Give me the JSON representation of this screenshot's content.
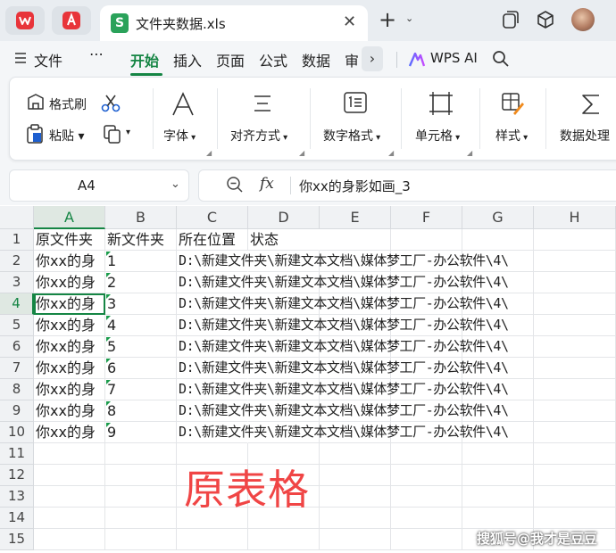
{
  "titlebar": {
    "doc_tab_title": "文件夹数据.xls",
    "doc_tab_icon_letter": "S",
    "close_glyph": "✕",
    "new_tab_glyph": "+",
    "tab_menu_glyph": "⌄"
  },
  "menubar": {
    "file_label": "文件",
    "more_label": "⋯",
    "tabs": [
      {
        "label": "开始",
        "active": true
      },
      {
        "label": "插入",
        "active": false
      },
      {
        "label": "页面",
        "active": false
      },
      {
        "label": "公式",
        "active": false
      },
      {
        "label": "数据",
        "active": false
      },
      {
        "label": "审",
        "active": false
      }
    ],
    "scroll_glyph": "›",
    "wps_ai_label": "WPS AI"
  },
  "ribbon": {
    "format_painter_label": "格式刷",
    "paste_label": "粘贴",
    "font_label": "字体",
    "align_label": "对齐方式",
    "number_format_label": "数字格式",
    "cell_label": "单元格",
    "style_label": "样式",
    "data_process_label": "数据处理"
  },
  "formula_bar": {
    "cell_ref": "A4",
    "fx_label": "fx",
    "formula_value": "你xx的身影如画_3"
  },
  "grid": {
    "selected_cell": "A4",
    "columns": [
      "A",
      "B",
      "C",
      "D",
      "E",
      "F",
      "G",
      "H"
    ],
    "rows": [
      "1",
      "2",
      "3",
      "4",
      "5",
      "6",
      "7",
      "8",
      "9",
      "10",
      "11",
      "12",
      "13",
      "14",
      "15"
    ],
    "header_row": {
      "a": "原文件夹",
      "b": "新文件夹",
      "c": "所在位置",
      "d": "状态"
    },
    "data_rows": [
      {
        "a": "你xx的身",
        "b": "1",
        "c": "D:\\新建文件夹\\新建文本文档\\媒体梦工厂-办公软件\\4\\"
      },
      {
        "a": "你xx的身",
        "b": "2",
        "c": "D:\\新建文件夹\\新建文本文档\\媒体梦工厂-办公软件\\4\\"
      },
      {
        "a": "你xx的身",
        "b": "3",
        "c": "D:\\新建文件夹\\新建文本文档\\媒体梦工厂-办公软件\\4\\"
      },
      {
        "a": "你xx的身",
        "b": "4",
        "c": "D:\\新建文件夹\\新建文本文档\\媒体梦工厂-办公软件\\4\\"
      },
      {
        "a": "你xx的身",
        "b": "5",
        "c": "D:\\新建文件夹\\新建文本文档\\媒体梦工厂-办公软件\\4\\"
      },
      {
        "a": "你xx的身",
        "b": "6",
        "c": "D:\\新建文件夹\\新建文本文档\\媒体梦工厂-办公软件\\4\\"
      },
      {
        "a": "你xx的身",
        "b": "7",
        "c": "D:\\新建文件夹\\新建文本文档\\媒体梦工厂-办公软件\\4\\"
      },
      {
        "a": "你xx的身",
        "b": "8",
        "c": "D:\\新建文件夹\\新建文本文档\\媒体梦工厂-办公软件\\4\\"
      },
      {
        "a": "你xx的身",
        "b": "9",
        "c": "D:\\新建文件夹\\新建文本文档\\媒体梦工厂-办公软件\\4\\"
      }
    ]
  },
  "overlay": {
    "big_label": "原表格",
    "credit": "搜狐号@我才是豆豆"
  },
  "colors": {
    "accent_green": "#158544",
    "watermark_red": "#f04545"
  }
}
